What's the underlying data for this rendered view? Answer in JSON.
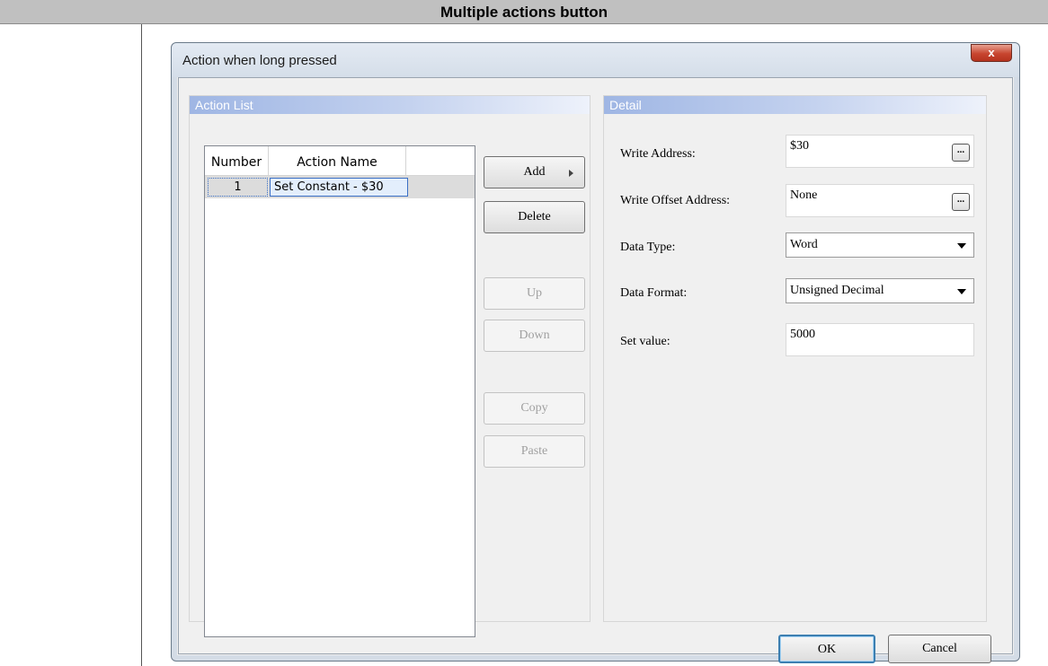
{
  "doc": {
    "header_title": "Multiple actions button"
  },
  "dialog": {
    "title": "Action when long pressed",
    "close_glyph": "x",
    "action_list": {
      "header": "Action List",
      "columns": [
        "Number",
        "Action Name"
      ],
      "rows": [
        {
          "number": "1",
          "name": "Set Constant - $30"
        }
      ]
    },
    "buttons": {
      "add": "Add",
      "delete": "Delete",
      "up": "Up",
      "down": "Down",
      "copy": "Copy",
      "paste": "Paste"
    },
    "detail": {
      "header": "Detail",
      "write_address_label": "Write Address:",
      "write_address_value": "$30",
      "write_offset_label": "Write Offset Address:",
      "write_offset_value": "None",
      "data_type_label": "Data Type:",
      "data_type_value": "Word",
      "data_format_label": "Data Format:",
      "data_format_value": "Unsigned Decimal",
      "set_value_label": "Set value:",
      "set_value_value": "5000",
      "browse_glyph": "..."
    },
    "ok_label": "OK",
    "cancel_label": "Cancel"
  }
}
